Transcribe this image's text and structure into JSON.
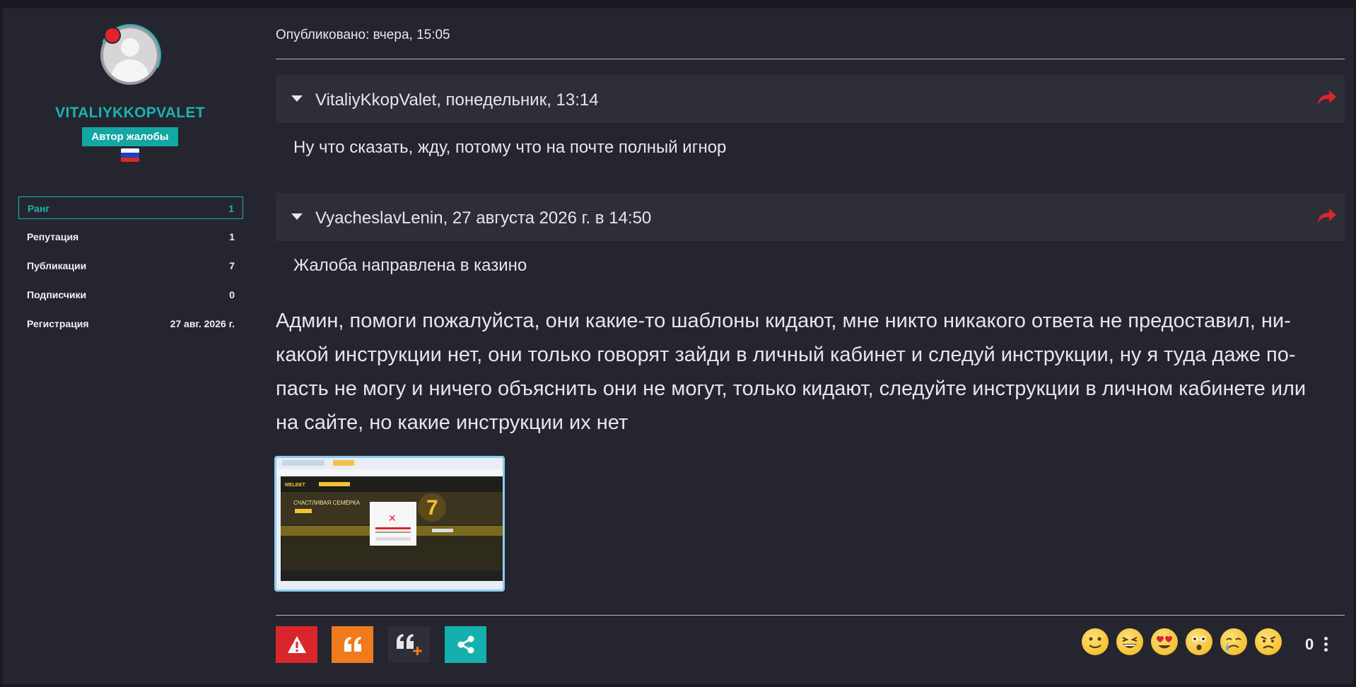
{
  "author": {
    "name": "VITALIYKKOPVALET",
    "badge": "Автор жалобы",
    "flag_colors": [
      "#ffffff",
      "#1c3fc8",
      "#d52b1e"
    ],
    "stats": [
      {
        "label": "Ранг",
        "value": "1"
      },
      {
        "label": "Репутация",
        "value": "1"
      },
      {
        "label": "Публикации",
        "value": "7"
      },
      {
        "label": "Подписчики",
        "value": "0"
      },
      {
        "label": "Регистрация",
        "value": "27 авг. 2026 г."
      }
    ]
  },
  "post": {
    "published": "Опубликовано: вчера, 15:05",
    "quotes": [
      {
        "author": "VitaliyKkopValet, понедельник, 13:14",
        "text": "Ну что сказать, жду, потому что на почте полный игнор"
      },
      {
        "author": "VyacheslavLenin, 27 августа 2026 г. в 14:50",
        "text": "Жалоба направлена в казино"
      }
    ],
    "body": "Админ, помоги пожалуйста, они какие-то шаблоны кидают, мне никто никакого ответа не предоставил, ни-какой инструкции нет, они только говорят зайди в личный кабинет и следуй инструкции, ну я туда даже по-пасть не могу и ничего объяснить они не могут, только кидают, следуйте инструкции в личном кабинете или на сайте, но какие инструкции их нет",
    "body_lines": [
      "Админ, помоги пожалуйста, они какие-то шаблоны кидают, мне никто никакого ответа не предоставил, ни-",
      "какой инструкции нет, они только говорят зайди в личный кабинет и следуй инструкции, ну я туда даже по-",
      "пасть не могу и ничего объяснить они не могут, только кидают, следуйте инструкции в личном кабинете или",
      "на сайте, но какие инструкции их нет"
    ],
    "attachment": {
      "site_banner": "СЧАСТЛИВАЯ СЕМЁРКА",
      "logo": "MELBET"
    }
  },
  "actions": [
    {
      "icon": "warning-icon",
      "color": "#d9262c"
    },
    {
      "icon": "quote-icon",
      "color": "#f07a1e"
    },
    {
      "icon": "multiquote-icon",
      "color": "#2e2e39"
    },
    {
      "icon": "share-icon",
      "color": "#14b0ad"
    }
  ],
  "reactions": {
    "icons": [
      "smile-emoji",
      "laugh-emoji",
      "heart-eyes-emoji",
      "astonished-emoji",
      "crying-emoji",
      "angry-emoji"
    ],
    "count": "0"
  },
  "colors": {
    "accent": "#19b3b0",
    "share_arrow": "#d9262c",
    "background": "#25252f"
  }
}
